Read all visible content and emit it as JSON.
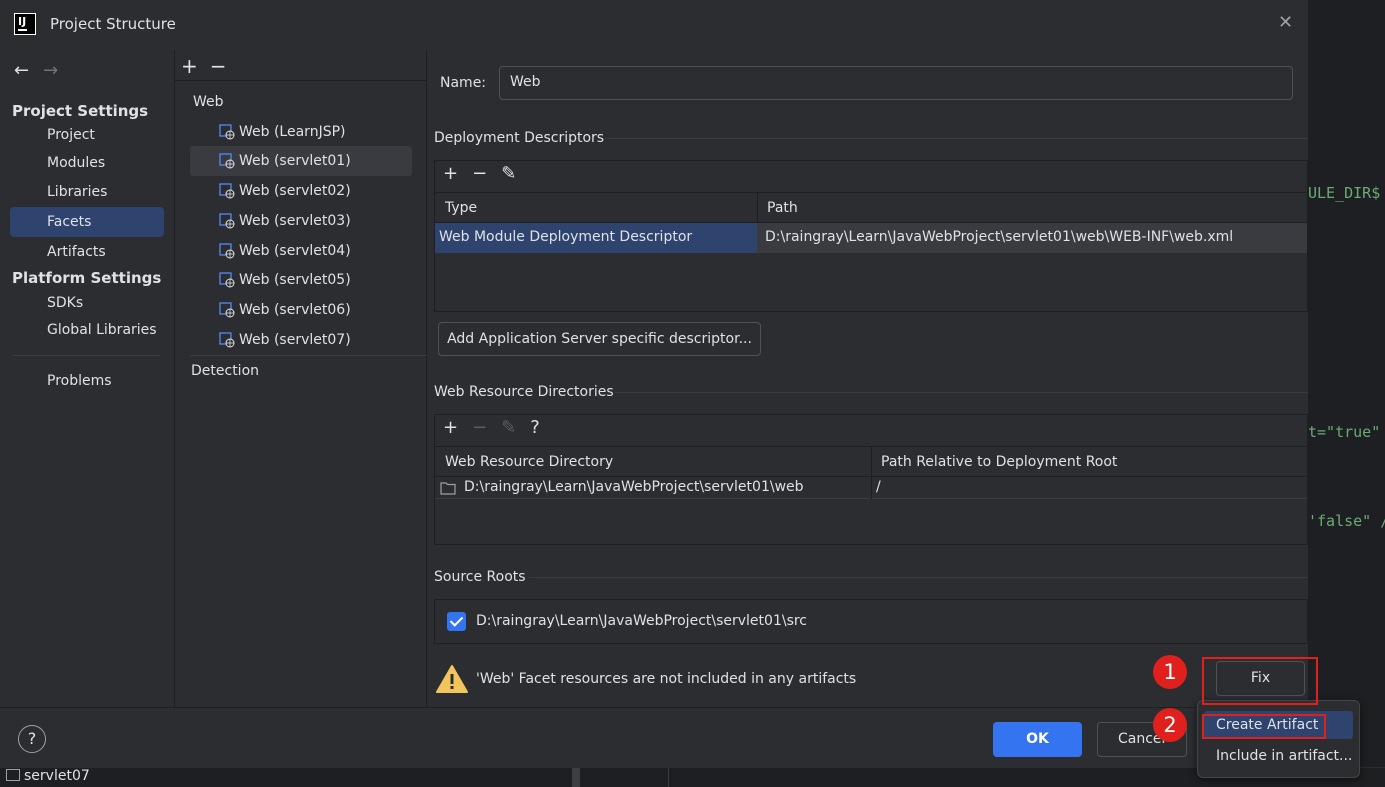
{
  "window": {
    "title": "Project Structure",
    "logo_text": "IJ"
  },
  "nav": {
    "back": "←",
    "forward": "→",
    "project_settings_header": "Project Settings",
    "project_settings": [
      "Project",
      "Modules",
      "Libraries",
      "Facets",
      "Artifacts"
    ],
    "selected": "Facets",
    "platform_settings_header": "Platform Settings",
    "platform_settings": [
      "SDKs",
      "Global Libraries"
    ],
    "problems": "Problems"
  },
  "facets": {
    "add": "+",
    "remove": "−",
    "group": "Web",
    "items": [
      "Web (LearnJSP)",
      "Web (servlet01)",
      "Web (servlet02)",
      "Web (servlet03)",
      "Web (servlet04)",
      "Web (servlet05)",
      "Web (servlet06)",
      "Web (servlet07)"
    ],
    "selected": "Web (servlet01)",
    "detection": "Detection"
  },
  "detail": {
    "name_label": "Name:",
    "name_value": "Web",
    "deployment": {
      "title": "Deployment Descriptors",
      "columns": [
        "Type",
        "Path"
      ],
      "rows": [
        {
          "type": "Web Module Deployment Descriptor",
          "path": "D:\\raingray\\Learn\\JavaWebProject\\servlet01\\web\\WEB-INF\\web.xml"
        }
      ],
      "add_server_button": "Add Application Server specific descriptor..."
    },
    "web_resources": {
      "title": "Web Resource Directories",
      "help": "?",
      "columns": [
        "Web Resource Directory",
        "Path Relative to Deployment Root"
      ],
      "rows": [
        {
          "dir": "D:\\raingray\\Learn\\JavaWebProject\\servlet01\\web",
          "rel": "/"
        }
      ]
    },
    "source_roots": {
      "title": "Source Roots",
      "items": [
        {
          "path": "D:\\raingray\\Learn\\JavaWebProject\\servlet01\\src",
          "checked": true
        }
      ]
    },
    "warning": "'Web' Facet resources are not included in any artifacts",
    "fix_button": "Fix"
  },
  "footer": {
    "help": "?",
    "ok": "OK",
    "cancel": "Cancel"
  },
  "popup": {
    "items": [
      "Create Artifact",
      "Include in artifact..."
    ],
    "selected": "Create Artifact"
  },
  "annotations": [
    "1",
    "2"
  ],
  "background": {
    "code_fragments": [
      "ULE_DIR$",
      "t=\"true\"",
      "'false\" /"
    ],
    "project_label": "servlet07"
  },
  "colors": {
    "accent": "#3574f0",
    "selection": "#2e436e",
    "annotation": "#e0201c",
    "warning": "#f2c55c"
  }
}
